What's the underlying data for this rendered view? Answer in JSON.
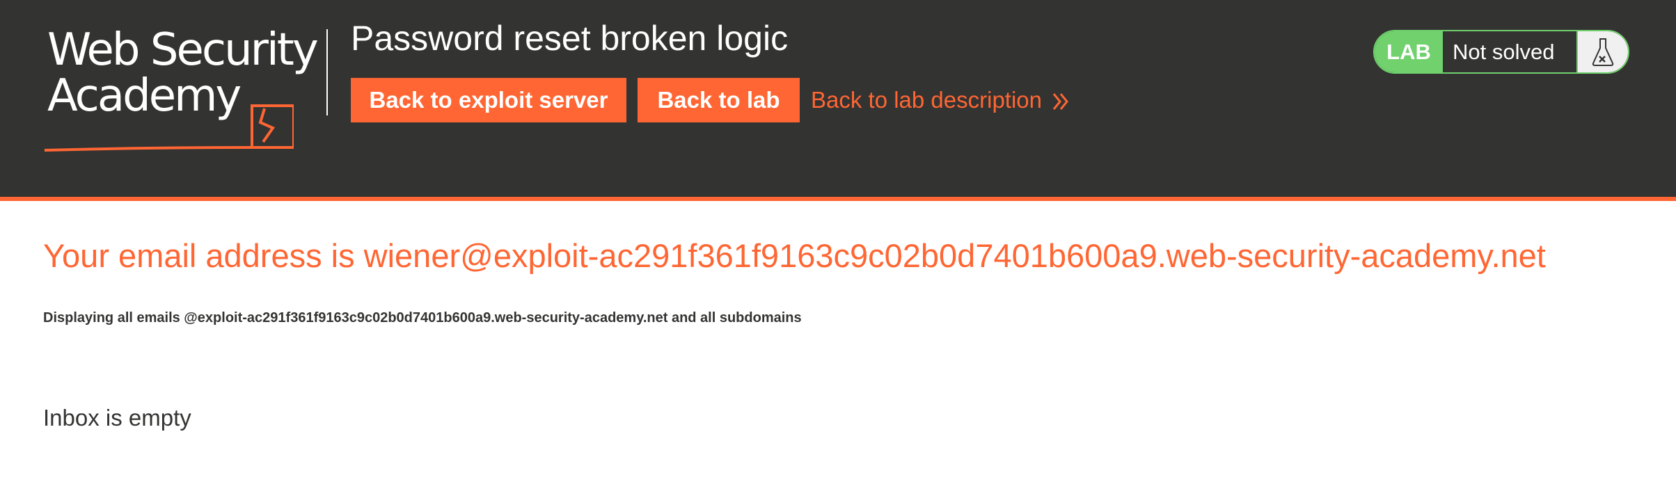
{
  "header": {
    "logo": {
      "line1": "Web Security",
      "line2": "Academy"
    },
    "lab_title": "Password reset broken logic",
    "buttons": {
      "exploit_server": "Back to exploit server",
      "lab": "Back to lab"
    },
    "description_link": "Back to lab description",
    "status": {
      "badge": "LAB",
      "text": "Not solved",
      "icon": "flask-icon"
    }
  },
  "main": {
    "email_heading": "Your email address is wiener@exploit-ac291f361f9163c9c02b0d7401b600a9.web-security-academy.net",
    "display_note": "Displaying all emails @exploit-ac291f361f9163c9c02b0d7401b600a9.web-security-academy.net and all subdomains",
    "inbox_status": "Inbox is empty"
  },
  "colors": {
    "header_bg": "#333332",
    "accent": "#ff6633",
    "status_green": "#70d16d",
    "text": "#333332"
  }
}
